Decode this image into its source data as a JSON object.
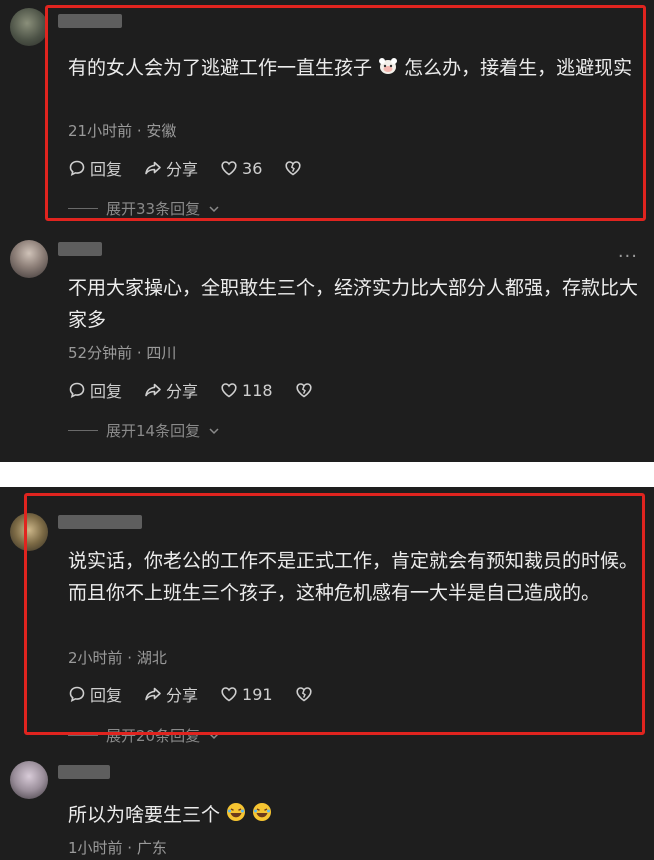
{
  "comments": [
    {
      "text": "有的女人会为了逃避工作一直生孩子 ",
      "text_after": " 怎么办，接着生，逃避现实",
      "meta": "21小时前 · 安徽",
      "reply": "回复",
      "share": "分享",
      "likes": "36",
      "expand": "展开33条回复"
    },
    {
      "text": "不用大家操心，全职敢生三个，经济实力比大部分人都强，存款比大家多",
      "meta": "52分钟前 · 四川",
      "reply": "回复",
      "share": "分享",
      "likes": "118",
      "expand": "展开14条回复",
      "more": "···"
    },
    {
      "text": "说实话，你老公的工作不是正式工作，肯定就会有预知裁员的时候。而且你不上班生三个孩子，这种危机感有一大半是自己造成的。",
      "meta": "2小时前 · 湖北",
      "reply": "回复",
      "share": "分享",
      "likes": "191",
      "expand": "展开20条回复"
    },
    {
      "text": "所以为啥要生三个 ",
      "meta": "1小时前 · 广东"
    }
  ],
  "icons": {
    "reply": "comment-bubble-icon",
    "share": "share-arrow-icon",
    "like": "heart-icon",
    "dislike": "broken-heart-icon",
    "expand": "chevron-down-icon",
    "emoji_sheep": "sheep-face-emoji",
    "emoji_laugh": "laughing-emoji"
  },
  "colors": {
    "highlight_box": "#e0241f",
    "background": "#1e1e1e"
  }
}
